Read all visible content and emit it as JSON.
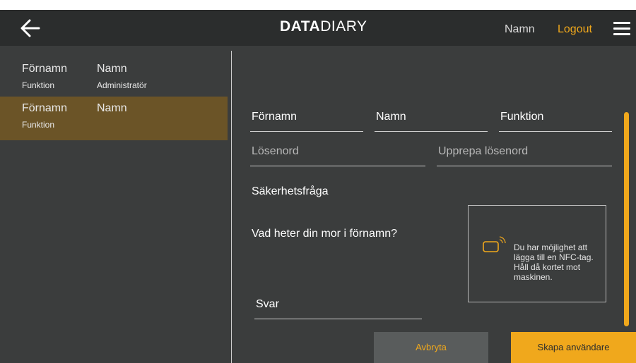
{
  "header": {
    "logo_bold": "DATA",
    "logo_light": "DIARY",
    "user_name": "Namn",
    "logout_label": "Logout",
    "back_icon": "arrow-left-icon",
    "menu_icon": "hamburger-menu-icon"
  },
  "sidebar": {
    "users": [
      {
        "first": "Förnamn",
        "last": "Namn",
        "function": "Funktion",
        "role": "Administratör",
        "selected": false
      },
      {
        "first": "Förnamn",
        "last": "Namn",
        "function": "Funktion",
        "role": "",
        "selected": true
      }
    ]
  },
  "form": {
    "first_name_value": "Förnamn",
    "last_name_value": "Namn",
    "function_value": "Funktion",
    "password_placeholder": "Lösenord",
    "repeat_password_placeholder": "Upprepa lösenord",
    "security_question_label": "Säkerhetsfråga",
    "security_question": "Vad heter din mor i förnamn?",
    "answer_value": "Svar"
  },
  "nfc": {
    "icon": "nfc-card-icon",
    "text": "Du har möjlighet att lägga till en NFC-tag. Håll då kortet mot maskinen."
  },
  "actions": {
    "cancel_label": "Avbryta",
    "create_label": "Skapa användare"
  },
  "colors": {
    "accent": "#f0a81c",
    "background": "#3b3d3d",
    "topbar": "#2b2d2d",
    "selected_row": "#6b5427"
  }
}
